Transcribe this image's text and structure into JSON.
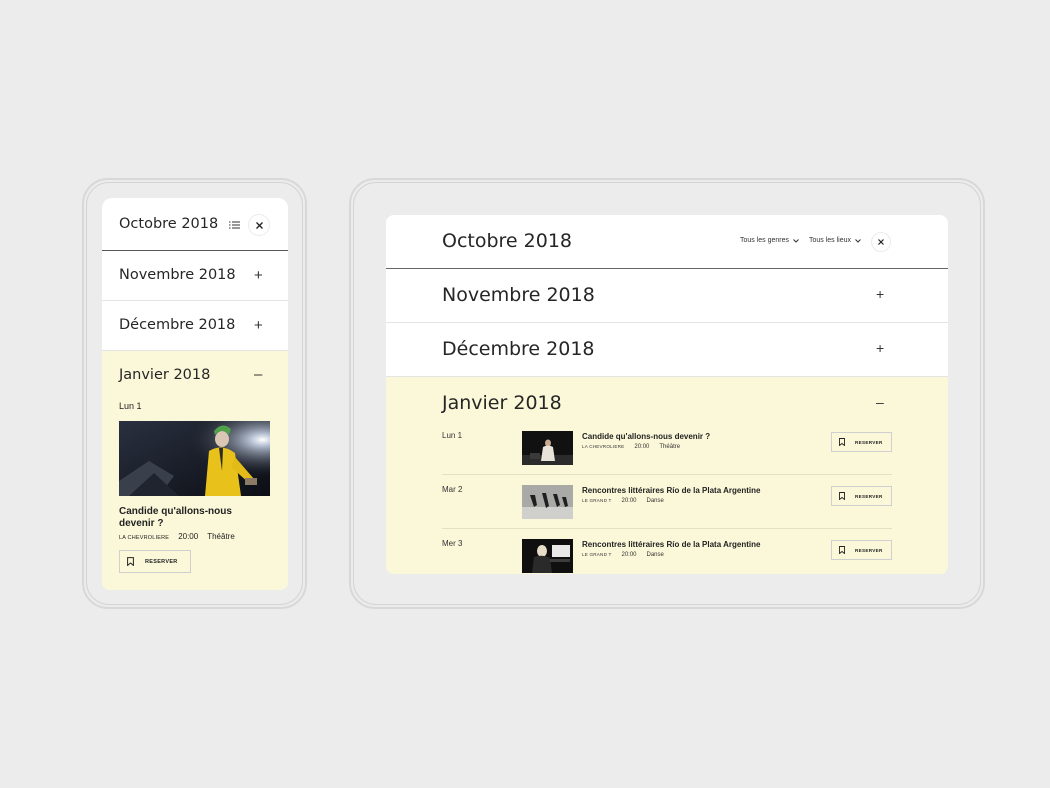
{
  "mobile": {
    "header": {
      "month": "Octobre 2018"
    },
    "months": [
      {
        "label": "Novembre 2018",
        "toggle": "+"
      },
      {
        "label": "Décembre 2018",
        "toggle": "+"
      }
    ],
    "open_month": {
      "label": "Janvier 2018",
      "toggle": "–"
    },
    "event": {
      "day": "Lun 1",
      "title": "Candide qu'allons-nous devenir ?",
      "venue": "LA CHEVROLIERE",
      "time": "20:00",
      "genre": "Théâtre",
      "reserve_label": "RESERVER"
    }
  },
  "tablet": {
    "header": {
      "month": "Octobre 2018",
      "genre_filter": "Tous les genres",
      "place_filter": "Tous les lieux"
    },
    "months": [
      {
        "label": "Novembre 2018",
        "toggle": "+"
      },
      {
        "label": "Décembre 2018",
        "toggle": "+"
      }
    ],
    "open_month": {
      "label": "Janvier 2018",
      "toggle": "–"
    },
    "events": [
      {
        "day": "Lun 1",
        "title": "Candide qu'allons-nous devenir ?",
        "venue": "LA CHEVROLIERE",
        "time": "20:00",
        "genre": "Théâtre",
        "reserve_label": "RESERVER"
      },
      {
        "day": "Mar 2",
        "title": "Rencontres littéraires Río de la Plata Argentine",
        "venue": "LE GRAND T",
        "time": "20:00",
        "genre": "Danse",
        "reserve_label": "RESERVER"
      },
      {
        "day": "Mer 3",
        "title": "Rencontres littéraires Río de la Plata Argentine",
        "venue": "LE GRAND T",
        "time": "20:00",
        "genre": "Danse",
        "reserve_label": "RESERVER"
      }
    ]
  }
}
